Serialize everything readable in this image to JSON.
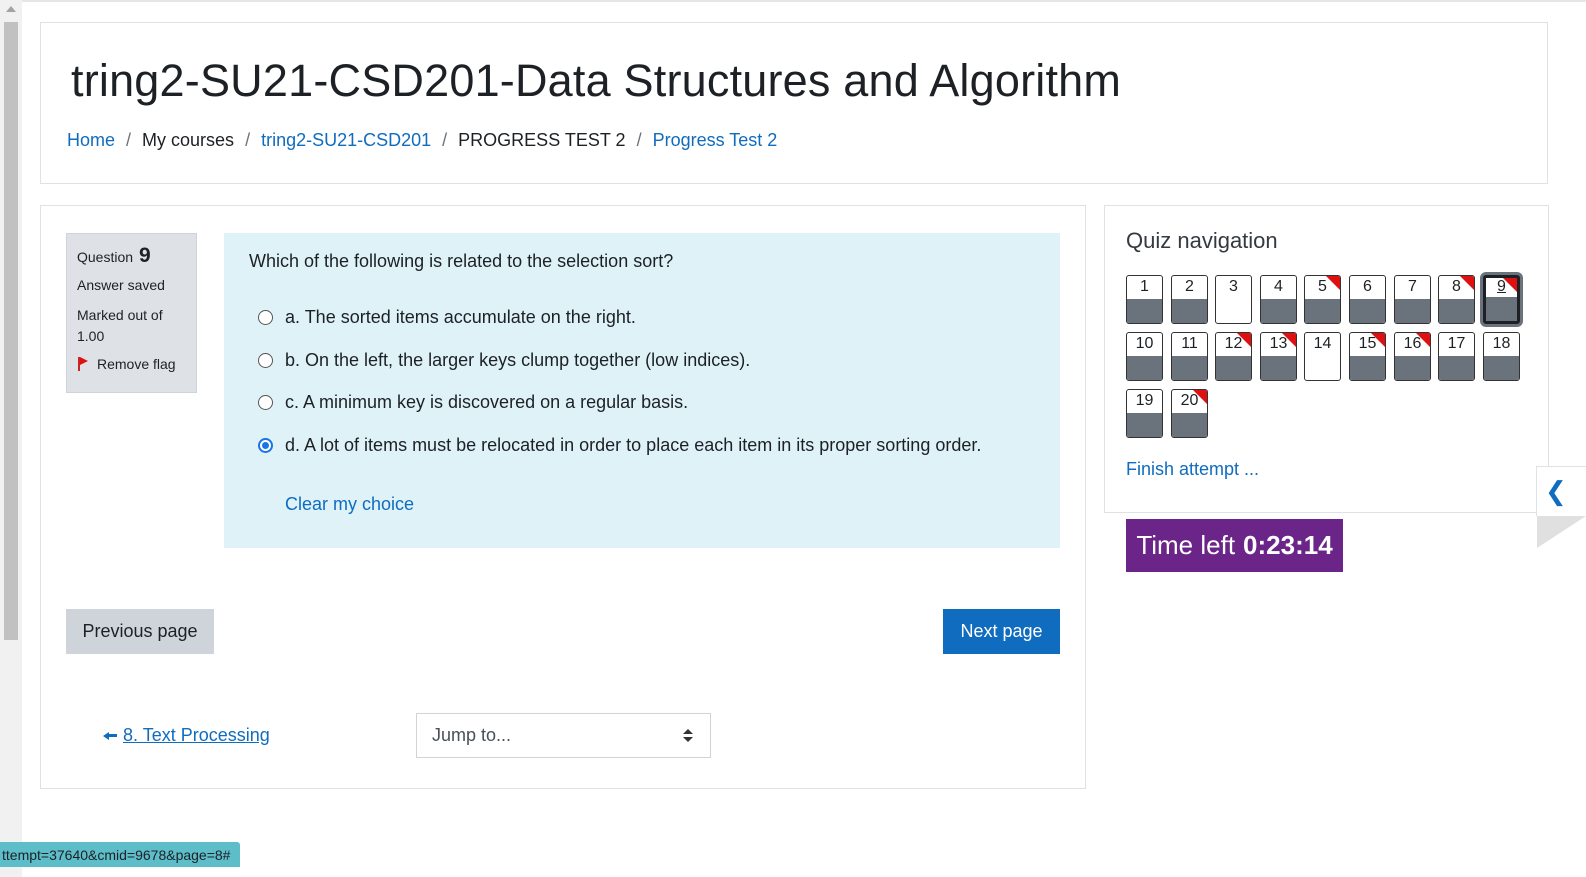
{
  "page": {
    "title": "tring2-SU21-CSD201-Data Structures and Algorithm",
    "breadcrumb": [
      {
        "label": "Home",
        "link": true
      },
      {
        "label": "My courses",
        "link": false
      },
      {
        "label": "tring2-SU21-CSD201",
        "link": true
      },
      {
        "label": "PROGRESS TEST 2",
        "link": false
      },
      {
        "label": "Progress Test 2",
        "link": true
      }
    ],
    "separator": "/"
  },
  "question_info": {
    "question_label": "Question",
    "question_number": "9",
    "state": "Answer saved",
    "grade_line1": "Marked out of",
    "grade_line2": "1.00",
    "flag_label": "Remove flag"
  },
  "question": {
    "text": "Which of the following is related to the selection sort?",
    "answers": [
      {
        "label": "a. The sorted items accumulate on the right.",
        "checked": false
      },
      {
        "label": "b. On the left, the larger keys clump together (low indices).",
        "checked": false
      },
      {
        "label": "c. A minimum key is discovered on a regular basis.",
        "checked": false
      },
      {
        "label": "d. A lot of items must be relocated in order to place each item in its proper sorting order.",
        "checked": true
      }
    ],
    "clear_label": "Clear my choice"
  },
  "buttons": {
    "previous": "Previous page",
    "next": "Next page"
  },
  "activity_nav": {
    "previous_activity": "8. Text Processing",
    "jump_placeholder": "Jump to..."
  },
  "quiz_nav": {
    "title": "Quiz navigation",
    "questions": [
      {
        "n": "1",
        "answered": true,
        "flagged": false,
        "current": false
      },
      {
        "n": "2",
        "answered": true,
        "flagged": false,
        "current": false
      },
      {
        "n": "3",
        "answered": false,
        "flagged": false,
        "current": false
      },
      {
        "n": "4",
        "answered": true,
        "flagged": false,
        "current": false
      },
      {
        "n": "5",
        "answered": true,
        "flagged": true,
        "current": false
      },
      {
        "n": "6",
        "answered": true,
        "flagged": false,
        "current": false
      },
      {
        "n": "7",
        "answered": true,
        "flagged": false,
        "current": false
      },
      {
        "n": "8",
        "answered": true,
        "flagged": true,
        "current": false
      },
      {
        "n": "9",
        "answered": true,
        "flagged": true,
        "current": true
      },
      {
        "n": "10",
        "answered": true,
        "flagged": false,
        "current": false
      },
      {
        "n": "11",
        "answered": true,
        "flagged": false,
        "current": false
      },
      {
        "n": "12",
        "answered": true,
        "flagged": true,
        "current": false
      },
      {
        "n": "13",
        "answered": true,
        "flagged": true,
        "current": false
      },
      {
        "n": "14",
        "answered": false,
        "flagged": false,
        "current": false
      },
      {
        "n": "15",
        "answered": true,
        "flagged": true,
        "current": false
      },
      {
        "n": "16",
        "answered": true,
        "flagged": true,
        "current": false
      },
      {
        "n": "17",
        "answered": true,
        "flagged": false,
        "current": false
      },
      {
        "n": "18",
        "answered": true,
        "flagged": false,
        "current": false
      },
      {
        "n": "19",
        "answered": true,
        "flagged": false,
        "current": false
      },
      {
        "n": "20",
        "answered": true,
        "flagged": true,
        "current": false
      }
    ],
    "finish_label": "Finish attempt ..."
  },
  "timer": {
    "label": "Time left",
    "value": "0:23:14"
  },
  "status_url": "ttempt=37640&cmid=9678&page=8#",
  "colors": {
    "link": "#0f6cbf",
    "question_bg": "#def2f8",
    "timer_bg": "#6b2488",
    "flag": "#dd1111",
    "answered_fill": "#6a737b"
  },
  "icons": {
    "flag": "flag-icon",
    "prev_activity": "arrow-left-icon",
    "select": "updown-icon",
    "drawer": "chevron-left-icon"
  }
}
